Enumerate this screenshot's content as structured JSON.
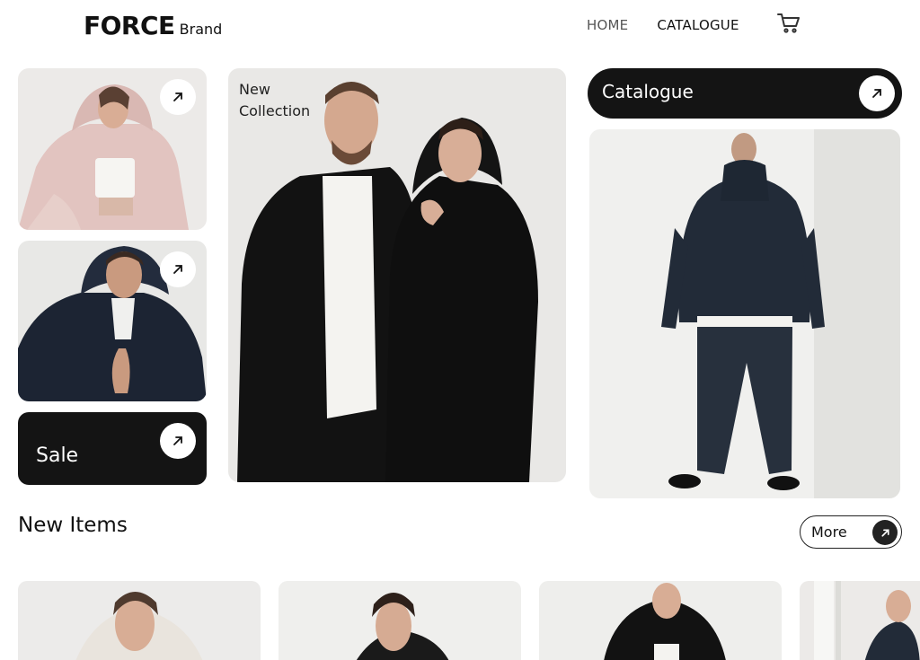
{
  "brand": {
    "name": "FORCE",
    "sub": "Brand"
  },
  "nav": {
    "home": "HOME",
    "catalogue": "CATALOGUE"
  },
  "hero": {
    "new_collection": "New\nCollection",
    "sale": "Sale",
    "catalogue": "Catalogue"
  },
  "section": {
    "title": "New Items",
    "more": "More"
  },
  "icons": {
    "cart": "cart-icon",
    "arrow": "arrow-up-right-icon"
  }
}
